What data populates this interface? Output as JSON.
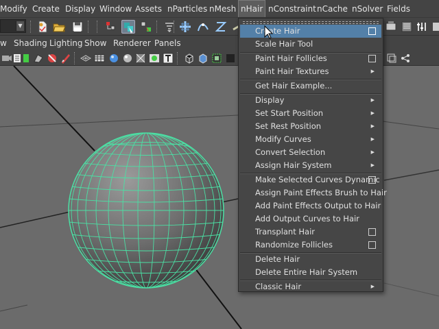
{
  "menubar": {
    "items": [
      "Modify",
      "Create",
      "Display",
      "Window",
      "Assets",
      "nParticles",
      "nMesh",
      "nHair",
      "nConstraint",
      "nCache",
      "nSolver",
      "Fields"
    ],
    "active": "nHair"
  },
  "panel_menu": {
    "items": [
      "w",
      "Shading",
      "Lighting",
      "Show",
      "Renderer",
      "Panels"
    ]
  },
  "nhair_menu": {
    "items": [
      {
        "label": "Create Hair",
        "option_box": true,
        "highlighted": true
      },
      {
        "label": "Scale Hair Tool"
      },
      {
        "label": "Paint Hair Follicles",
        "option_box": true
      },
      {
        "label": "Paint Hair Textures",
        "submenu": true
      },
      {
        "label": "Get Hair Example..."
      },
      {
        "label": "Display",
        "submenu": true
      },
      {
        "label": "Set Start Position",
        "submenu": true
      },
      {
        "label": "Set Rest Position",
        "submenu": true
      },
      {
        "label": "Modify Curves",
        "submenu": true
      },
      {
        "label": "Convert Selection",
        "submenu": true
      },
      {
        "label": "Assign Hair System",
        "submenu": true
      },
      {
        "label": "Make Selected Curves Dynamic",
        "option_box": true
      },
      {
        "label": "Assign Paint Effects Brush to Hair"
      },
      {
        "label": "Add Paint Effects Output to Hair"
      },
      {
        "label": "Add Output Curves to Hair"
      },
      {
        "label": "Transplant Hair",
        "option_box": true
      },
      {
        "label": "Randomize Follicles",
        "option_box": true
      },
      {
        "label": "Delete Hair"
      },
      {
        "label": "Delete Entire Hair System"
      },
      {
        "label": "Classic Hair",
        "submenu": true
      }
    ]
  },
  "icons": {
    "shelf": [
      "new-scene-icon",
      "open-scene-icon",
      "save-scene-icon",
      "select-hierarchy-icon",
      "select-object-icon",
      "select-component-icon",
      "snap-grid-icon",
      "snap-curve-icon",
      "snap-point-icon",
      "snap-surface-icon",
      "make-live-icon",
      "history-icon",
      "render-icon",
      "ipr-render-icon",
      "render-settings-icon",
      "hypershade-icon",
      "attribute-editor-icon"
    ],
    "panel": [
      "camera-select-icon",
      "camera-attributes-icon",
      "bookmark-icon",
      "image-plane-icon",
      "grid-icon",
      "film-gate-icon",
      "resolution-gate-icon",
      "gate-mask-icon",
      "field-chart-icon",
      "safe-action-icon",
      "safe-title-icon",
      "wireframe-icon",
      "smooth-shade-icon",
      "textured-icon",
      "lights-icon",
      "shadows-icon",
      "xray-icon"
    ]
  },
  "colors": {
    "wireframe": "#4be0a4",
    "menu_highlight": "#5380a8",
    "viewport_bg": "#6b6b6b"
  }
}
